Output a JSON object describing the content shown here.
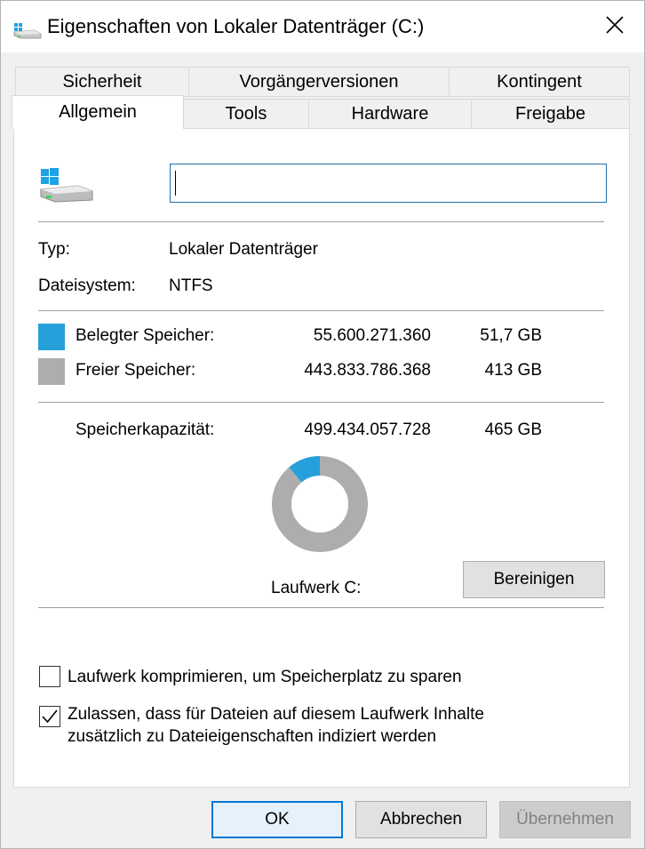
{
  "window": {
    "title": "Eigenschaften von Lokaler Datenträger (C:)"
  },
  "tabs": {
    "row_back": [
      "Sicherheit",
      "Vorgängerversionen",
      "Kontingent"
    ],
    "row_front": [
      "Allgemein",
      "Tools",
      "Hardware",
      "Freigabe"
    ],
    "active": "Allgemein"
  },
  "general": {
    "name_value": "",
    "type_label": "Typ:",
    "type_value": "Lokaler Datenträger",
    "fs_label": "Dateisystem:",
    "fs_value": "NTFS",
    "used_label": "Belegter Speicher:",
    "used_bytes": "55.600.271.360",
    "used_size": "51,7 GB",
    "free_label": "Freier Speicher:",
    "free_bytes": "443.833.786.368",
    "free_size": "413 GB",
    "capacity_label": "Speicherkapazität:",
    "capacity_bytes": "499.434.057.728",
    "capacity_size": "465 GB",
    "drive_label": "Laufwerk C:",
    "cleanup_label": "Bereinigen",
    "used_fraction": 0.111,
    "used_color": "#26a0da",
    "free_color": "#adadad"
  },
  "options": {
    "compress_label": "Laufwerk komprimieren, um Speicherplatz zu sparen",
    "compress_checked": false,
    "index_label_line1": "Zulassen, dass für Dateien auf diesem Laufwerk Inhalte",
    "index_label_line2": "zusätzlich zu Dateieigenschaften indiziert werden",
    "index_checked": true
  },
  "buttons": {
    "ok": "OK",
    "cancel": "Abbrechen",
    "apply": "Übernehmen"
  },
  "icons": {
    "title": "drive-icon",
    "close": "close-icon",
    "drive": "windows-drive-icon"
  }
}
